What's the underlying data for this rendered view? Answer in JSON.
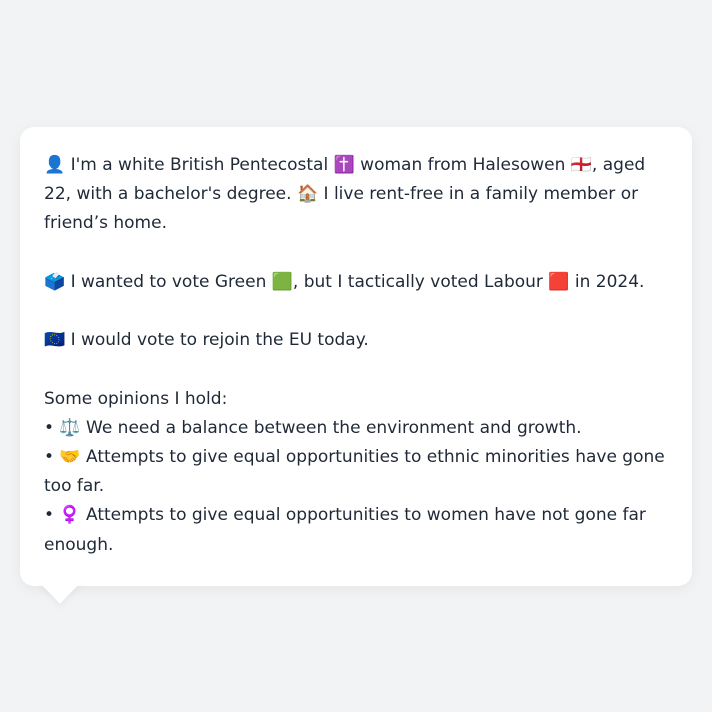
{
  "message": {
    "intro": "👤 I'm a white British Pentecostal ✝️ woman from Halesowen 🏴󠁧󠁢󠁥󠁮󠁧󠁿, aged 22, with a bachelor's degree. 🏠 I live rent-free in a family member or friend’s home.",
    "vote": "🗳️ I wanted to vote Green 🟩, but I tactically voted Labour 🟥 in 2024.",
    "eu": "🇪🇺 I would vote to rejoin the EU today.",
    "opinions_heading": "Some opinions I hold:",
    "opinions": [
      "• ⚖️ We need a balance between the environment and growth.",
      "• 🤝 Attempts to give equal opportunities to ethnic minorities have gone too far.",
      "• ♀️ Attempts to give equal opportunities to women have not gone far enough."
    ]
  }
}
